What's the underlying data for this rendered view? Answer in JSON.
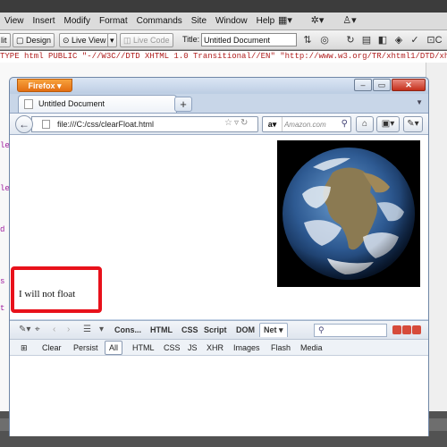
{
  "dreamweaver": {
    "menu": [
      "View",
      "Insert",
      "Modify",
      "Format",
      "Commands",
      "Site",
      "Window",
      "Help"
    ],
    "toolbar": {
      "split_label": "lit",
      "design_label": "Design",
      "live_view_label": "Live View",
      "live_code_label": "Live Code",
      "title_label": "Title:",
      "title_value": "Untitled Document",
      "code_label": "C"
    },
    "code_line": "TYPE html PUBLIC \"-//W3C//DTD XHTML 1.0 Transitional//EN\" \"http://www.w3.org/TR/xhtml1/DTD/xhtml1-tra"
  },
  "firefox": {
    "app_button": "Firefox",
    "tab_title": "Untitled Document",
    "new_tab": "+",
    "url": "file:///C:/css/clearFloat.html",
    "search_engine": "a",
    "search_placeholder": "Amazon.com",
    "page_text": "I will not float"
  },
  "firebug": {
    "tabs": [
      "Cons...",
      "HTML",
      "CSS",
      "Script",
      "DOM",
      "Net"
    ],
    "active_tab": "Net",
    "net_filters": [
      "Clear",
      "Persist",
      "All",
      "HTML",
      "CSS",
      "JS",
      "XHR",
      "Images",
      "Flash",
      "Media"
    ],
    "active_filter": "All"
  },
  "colors": {
    "highlight": "#e8111b",
    "firefox_orange": "#f08a24"
  }
}
